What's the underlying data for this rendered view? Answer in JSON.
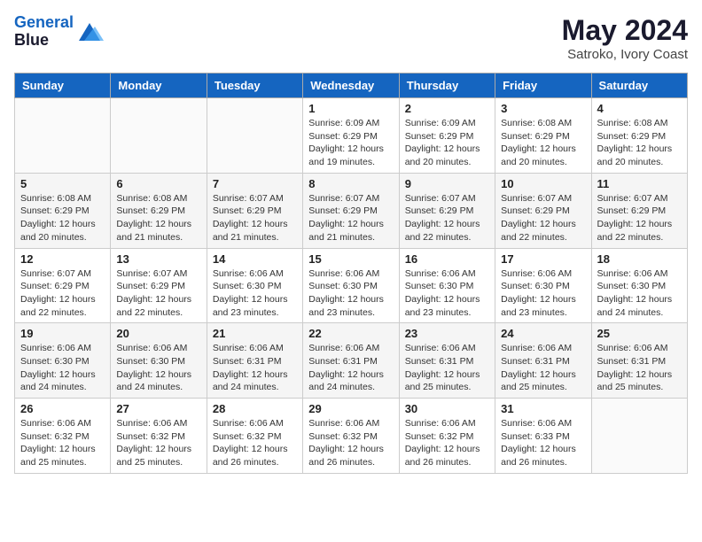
{
  "header": {
    "logo_line1": "General",
    "logo_line2": "Blue",
    "month_year": "May 2024",
    "location": "Satroko, Ivory Coast"
  },
  "weekdays": [
    "Sunday",
    "Monday",
    "Tuesday",
    "Wednesday",
    "Thursday",
    "Friday",
    "Saturday"
  ],
  "weeks": [
    [
      {
        "day": "",
        "info": ""
      },
      {
        "day": "",
        "info": ""
      },
      {
        "day": "",
        "info": ""
      },
      {
        "day": "1",
        "info": "Sunrise: 6:09 AM\nSunset: 6:29 PM\nDaylight: 12 hours\nand 19 minutes."
      },
      {
        "day": "2",
        "info": "Sunrise: 6:09 AM\nSunset: 6:29 PM\nDaylight: 12 hours\nand 20 minutes."
      },
      {
        "day": "3",
        "info": "Sunrise: 6:08 AM\nSunset: 6:29 PM\nDaylight: 12 hours\nand 20 minutes."
      },
      {
        "day": "4",
        "info": "Sunrise: 6:08 AM\nSunset: 6:29 PM\nDaylight: 12 hours\nand 20 minutes."
      }
    ],
    [
      {
        "day": "5",
        "info": "Sunrise: 6:08 AM\nSunset: 6:29 PM\nDaylight: 12 hours\nand 20 minutes."
      },
      {
        "day": "6",
        "info": "Sunrise: 6:08 AM\nSunset: 6:29 PM\nDaylight: 12 hours\nand 21 minutes."
      },
      {
        "day": "7",
        "info": "Sunrise: 6:07 AM\nSunset: 6:29 PM\nDaylight: 12 hours\nand 21 minutes."
      },
      {
        "day": "8",
        "info": "Sunrise: 6:07 AM\nSunset: 6:29 PM\nDaylight: 12 hours\nand 21 minutes."
      },
      {
        "day": "9",
        "info": "Sunrise: 6:07 AM\nSunset: 6:29 PM\nDaylight: 12 hours\nand 22 minutes."
      },
      {
        "day": "10",
        "info": "Sunrise: 6:07 AM\nSunset: 6:29 PM\nDaylight: 12 hours\nand 22 minutes."
      },
      {
        "day": "11",
        "info": "Sunrise: 6:07 AM\nSunset: 6:29 PM\nDaylight: 12 hours\nand 22 minutes."
      }
    ],
    [
      {
        "day": "12",
        "info": "Sunrise: 6:07 AM\nSunset: 6:29 PM\nDaylight: 12 hours\nand 22 minutes."
      },
      {
        "day": "13",
        "info": "Sunrise: 6:07 AM\nSunset: 6:29 PM\nDaylight: 12 hours\nand 22 minutes."
      },
      {
        "day": "14",
        "info": "Sunrise: 6:06 AM\nSunset: 6:30 PM\nDaylight: 12 hours\nand 23 minutes."
      },
      {
        "day": "15",
        "info": "Sunrise: 6:06 AM\nSunset: 6:30 PM\nDaylight: 12 hours\nand 23 minutes."
      },
      {
        "day": "16",
        "info": "Sunrise: 6:06 AM\nSunset: 6:30 PM\nDaylight: 12 hours\nand 23 minutes."
      },
      {
        "day": "17",
        "info": "Sunrise: 6:06 AM\nSunset: 6:30 PM\nDaylight: 12 hours\nand 23 minutes."
      },
      {
        "day": "18",
        "info": "Sunrise: 6:06 AM\nSunset: 6:30 PM\nDaylight: 12 hours\nand 24 minutes."
      }
    ],
    [
      {
        "day": "19",
        "info": "Sunrise: 6:06 AM\nSunset: 6:30 PM\nDaylight: 12 hours\nand 24 minutes."
      },
      {
        "day": "20",
        "info": "Sunrise: 6:06 AM\nSunset: 6:30 PM\nDaylight: 12 hours\nand 24 minutes."
      },
      {
        "day": "21",
        "info": "Sunrise: 6:06 AM\nSunset: 6:31 PM\nDaylight: 12 hours\nand 24 minutes."
      },
      {
        "day": "22",
        "info": "Sunrise: 6:06 AM\nSunset: 6:31 PM\nDaylight: 12 hours\nand 24 minutes."
      },
      {
        "day": "23",
        "info": "Sunrise: 6:06 AM\nSunset: 6:31 PM\nDaylight: 12 hours\nand 25 minutes."
      },
      {
        "day": "24",
        "info": "Sunrise: 6:06 AM\nSunset: 6:31 PM\nDaylight: 12 hours\nand 25 minutes."
      },
      {
        "day": "25",
        "info": "Sunrise: 6:06 AM\nSunset: 6:31 PM\nDaylight: 12 hours\nand 25 minutes."
      }
    ],
    [
      {
        "day": "26",
        "info": "Sunrise: 6:06 AM\nSunset: 6:32 PM\nDaylight: 12 hours\nand 25 minutes."
      },
      {
        "day": "27",
        "info": "Sunrise: 6:06 AM\nSunset: 6:32 PM\nDaylight: 12 hours\nand 25 minutes."
      },
      {
        "day": "28",
        "info": "Sunrise: 6:06 AM\nSunset: 6:32 PM\nDaylight: 12 hours\nand 26 minutes."
      },
      {
        "day": "29",
        "info": "Sunrise: 6:06 AM\nSunset: 6:32 PM\nDaylight: 12 hours\nand 26 minutes."
      },
      {
        "day": "30",
        "info": "Sunrise: 6:06 AM\nSunset: 6:32 PM\nDaylight: 12 hours\nand 26 minutes."
      },
      {
        "day": "31",
        "info": "Sunrise: 6:06 AM\nSunset: 6:33 PM\nDaylight: 12 hours\nand 26 minutes."
      },
      {
        "day": "",
        "info": ""
      }
    ]
  ]
}
